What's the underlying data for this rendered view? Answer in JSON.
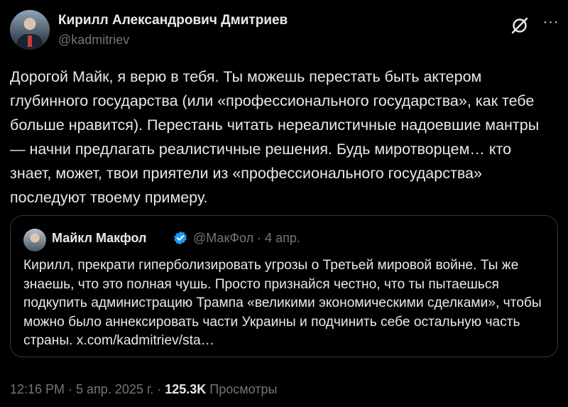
{
  "author": {
    "name": "Кирилл Александрович Дмитриев",
    "handle": "@kadmitriev"
  },
  "post": {
    "text": "Дорогой Майк, я верю в тебя. Ты можешь перестать быть актером глубинного государства (или «профессионального государства», как тебе больше нравится). Перестань читать нереалистичные надоевшие мантры — начни предлагать реалистичные решения. Будь миротворцем… кто знает, может, твои приятели из «профессионального государства» последуют твоему примеру."
  },
  "quoted": {
    "name": "Майкл Макфол",
    "handle_date": "@МакФол · 4 апр.",
    "text": "Кирилл, прекрати гиперболизировать угрозы о Третьей мировой войне. Ты же знаешь, что это полная чушь. Просто признайся честно, что ты пытаешься подкупить администрацию Трампа «великими экономическими сделками», чтобы можно было аннексировать части Украины и подчинить себе остальную часть страны. x.com/kadmitriev/sta…"
  },
  "meta": {
    "time_date": "12:16 PM · 5 апр. 2025 г. · ",
    "views": "125.3K",
    "views_label": " Просмотры"
  },
  "icons": {
    "grok": "grok-icon",
    "more": "more-icon",
    "verified": "verified-icon"
  },
  "colors": {
    "background": "#000000",
    "text": "#e7e9ea",
    "secondary": "#71767b",
    "verified": "#1d9bf0",
    "border": "#333639"
  }
}
